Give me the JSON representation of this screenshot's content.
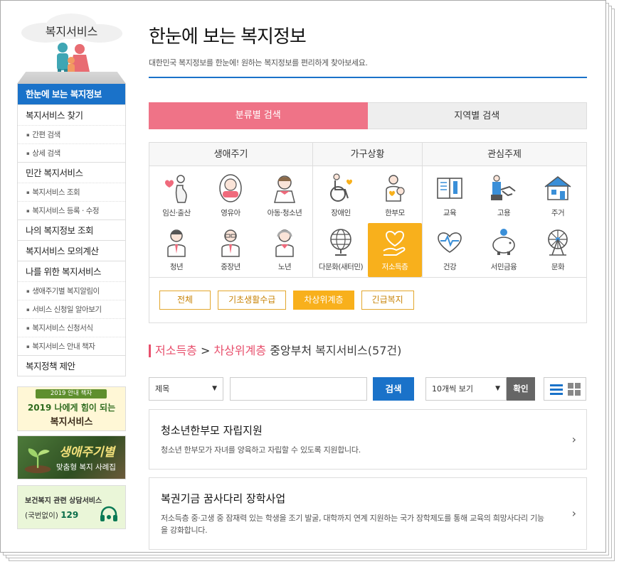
{
  "sidebar": {
    "title": "복지서비스",
    "menu": [
      {
        "type": "active",
        "label": "한눈에 보는 복지정보"
      },
      {
        "type": "item",
        "label": "복지서비스 찾기"
      },
      {
        "type": "sub",
        "label": "간편 검색"
      },
      {
        "type": "sub",
        "label": "상세 검색"
      },
      {
        "type": "item",
        "label": "민간 복지서비스"
      },
      {
        "type": "sub",
        "label": "복지서비스 조회"
      },
      {
        "type": "sub",
        "label": "복지서비스 등록 · 수정"
      },
      {
        "type": "item",
        "label": "나의 복지정보 조회"
      },
      {
        "type": "item",
        "label": "복지서비스 모의계산"
      },
      {
        "type": "item",
        "label": "나를 위한 복지서비스"
      },
      {
        "type": "sub",
        "label": "생애주기별 복지알림이"
      },
      {
        "type": "sub",
        "label": "서비스 신청일 알아보기"
      },
      {
        "type": "sub",
        "label": "복지서비스 신청서식"
      },
      {
        "type": "sub",
        "label": "복지서비스 안내 책자"
      },
      {
        "type": "item",
        "label": "복지정책 제안"
      }
    ],
    "banner1": {
      "tag": "2019 안내 책자",
      "line1": "2019 나에게 힘이 되는",
      "line2": "복지서비스"
    },
    "banner2": {
      "line1": "생애주기별",
      "line2": "맞춤형 복지 사례집"
    },
    "banner3": {
      "line1": "보건복지 관련 상담서비스",
      "prefix": "(국번없이)",
      "number": "129"
    }
  },
  "header": {
    "title": "한눈에 보는 복지정보",
    "subtitle": "대한민국 복지정보를 한눈에! 원하는 복지정보를 편리하게 찾아보세요."
  },
  "tabs": [
    {
      "label": "분류별 검색",
      "active": true
    },
    {
      "label": "지역별 검색",
      "active": false
    }
  ],
  "categories": {
    "groups": [
      {
        "title": "생애주기",
        "items": [
          {
            "label": "임신·출산",
            "icon": "pregnant-icon"
          },
          {
            "label": "영유아",
            "icon": "baby-icon"
          },
          {
            "label": "아동·청소년",
            "icon": "child-icon"
          },
          {
            "label": "청년",
            "icon": "youth-icon"
          },
          {
            "label": "중장년",
            "icon": "middle-age-icon"
          },
          {
            "label": "노년",
            "icon": "elderly-icon"
          }
        ]
      },
      {
        "title": "가구상황",
        "items": [
          {
            "label": "장애인",
            "icon": "wheelchair-icon"
          },
          {
            "label": "한부모",
            "icon": "single-parent-icon"
          },
          {
            "label": "다문화(새터민)",
            "icon": "globe-icon"
          },
          {
            "label": "저소득층",
            "icon": "heart-hand-icon",
            "active": true
          }
        ]
      },
      {
        "title": "관심주제",
        "items": [
          {
            "label": "교육",
            "icon": "book-icon"
          },
          {
            "label": "고용",
            "icon": "handshake-icon"
          },
          {
            "label": "주거",
            "icon": "house-icon"
          },
          {
            "label": "건강",
            "icon": "health-heart-icon"
          },
          {
            "label": "서민금융",
            "icon": "piggy-bank-icon"
          },
          {
            "label": "문화",
            "icon": "ferris-wheel-icon"
          }
        ]
      }
    ],
    "filters": [
      {
        "label": "전체",
        "active": false
      },
      {
        "label": "기초생활수급",
        "active": false
      },
      {
        "label": "차상위계층",
        "active": true
      },
      {
        "label": "긴급복지",
        "active": false
      }
    ]
  },
  "result": {
    "category": "저소득층",
    "separator": ">",
    "filter": "차상위계층",
    "scope": "중앙부처",
    "suffix": "복지서비스(57건)"
  },
  "search": {
    "field_select": "제목",
    "query": "",
    "button": "검색",
    "page_size_select": "10개씩 보기",
    "confirm": "확인"
  },
  "cards": [
    {
      "title": "청소년한부모 자립지원",
      "desc": "청소년 한부모가 자녀를 양육하고 자립할 수 있도록 지원합니다."
    },
    {
      "title": "복권기금 꿈사다리 장학사업",
      "desc": "저소득층 중·고생 중 잠재력 있는 학생을 조기 발굴, 대학까지 연계 지원하는 국가 장학제도를 통해 교육의 희망사다리 기능을 강화합니다."
    }
  ],
  "colors": {
    "primary": "#1a72c9",
    "pink": "#ef7387",
    "orange": "#f8b01c"
  }
}
